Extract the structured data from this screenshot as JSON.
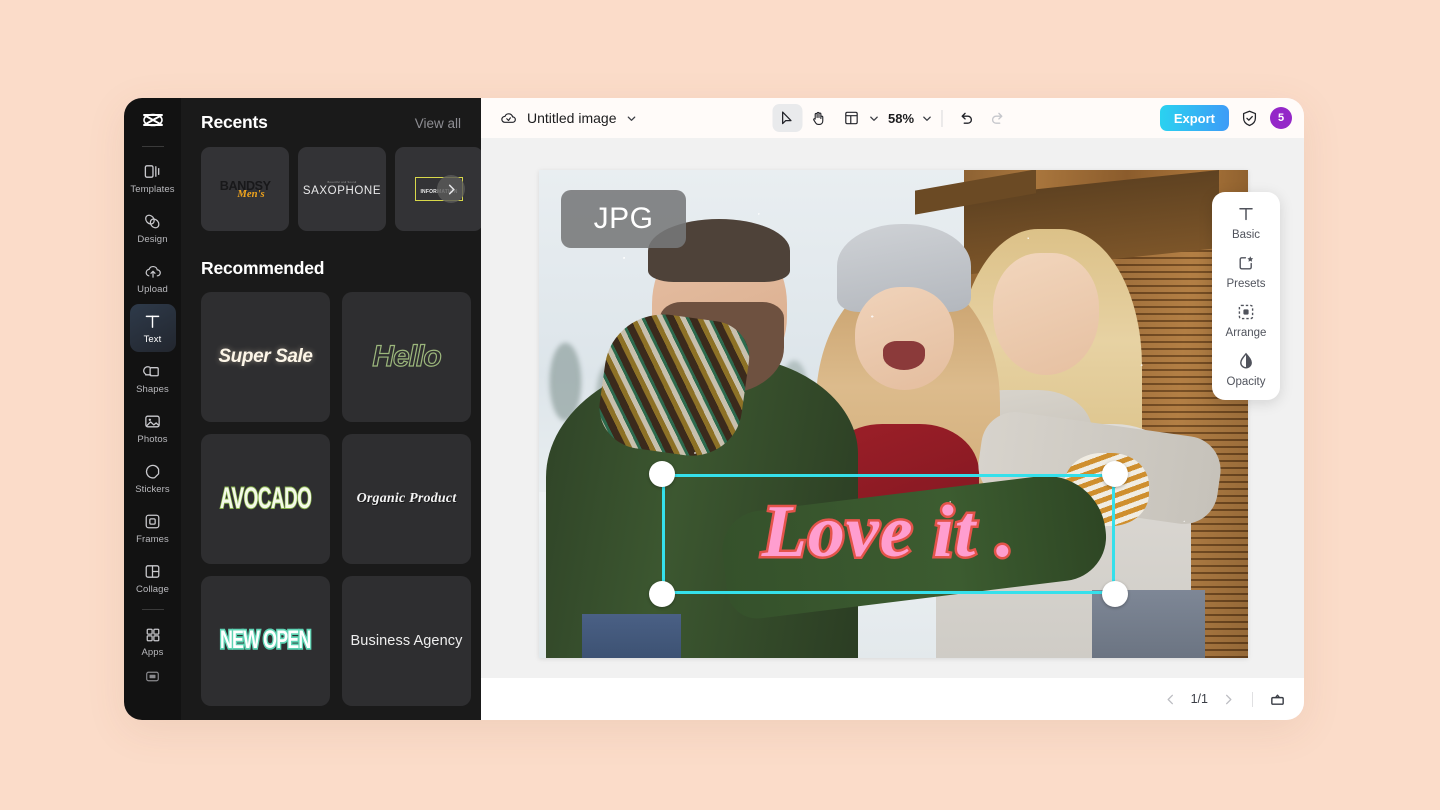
{
  "app": {
    "logo_icon": "capcut-logo-icon"
  },
  "rail": {
    "items": [
      {
        "label": "Templates",
        "icon": "templates-icon",
        "active": false
      },
      {
        "label": "Design",
        "icon": "design-icon",
        "active": false
      },
      {
        "label": "Upload",
        "icon": "upload-cloud-icon",
        "active": false
      },
      {
        "label": "Text",
        "icon": "text-t-icon",
        "active": true
      },
      {
        "label": "Shapes",
        "icon": "shapes-icon",
        "active": false
      },
      {
        "label": "Photos",
        "icon": "photos-image-icon",
        "active": false
      },
      {
        "label": "Stickers",
        "icon": "stickers-icon",
        "active": false
      },
      {
        "label": "Frames",
        "icon": "frames-icon",
        "active": false
      },
      {
        "label": "Collage",
        "icon": "collage-icon",
        "active": false
      },
      {
        "label": "Apps",
        "icon": "apps-grid-icon",
        "active": false
      }
    ],
    "bottom_icon": "keyboard-icon"
  },
  "panel": {
    "recents_title": "Recents",
    "view_all": "View all",
    "recents": [
      {
        "line1": "BANDSY",
        "line2": "Men's"
      },
      {
        "line1": "Beautiful and Sound",
        "line2": "SAXOPHONE"
      },
      {
        "line1": "INFORMATION",
        "line2": ""
      }
    ],
    "next_icon": "chevron-right-icon",
    "recommended_title": "Recommended",
    "recommended": [
      {
        "label": "Super Sale"
      },
      {
        "label": "Hello"
      },
      {
        "label": "AVOCADO"
      },
      {
        "label": "Organic Product"
      },
      {
        "label": "NEW OPEN"
      },
      {
        "label": "Business Agency"
      }
    ]
  },
  "topbar": {
    "cloud_icon": "cloud-save-icon",
    "doc_title": "Untitled image",
    "doc_chevron": "chevron-down-icon",
    "tools": [
      {
        "name": "select-tool",
        "icon": "cursor-arrow-icon",
        "active": true
      },
      {
        "name": "hand-tool",
        "icon": "hand-icon",
        "active": false
      },
      {
        "name": "layout-tool",
        "icon": "layout-panel-icon",
        "active": false
      }
    ],
    "zoom": "58%",
    "undo_icon": "undo-arrow-icon",
    "redo_icon": "redo-arrow-icon",
    "export_label": "Export",
    "shield_icon": "shield-check-icon",
    "avatar_count": "5",
    "avatar_color": "#9427C8",
    "export_color": "#2AD2F0"
  },
  "canvas": {
    "format_badge": "JPG",
    "text_object": {
      "content": "Love it .",
      "fill_color": "#FF9ECF",
      "stroke_color": "#E4534A"
    },
    "selection_color": "#35E0EB"
  },
  "float_panel": {
    "items": [
      {
        "label": "Basic",
        "icon": "text-t-icon"
      },
      {
        "label": "Presets",
        "icon": "presets-star-square-icon"
      },
      {
        "label": "Arrange",
        "icon": "arrange-dashed-box-icon"
      },
      {
        "label": "Opacity",
        "icon": "opacity-droplet-icon"
      }
    ]
  },
  "bottombar": {
    "prev_icon": "chevron-left-icon",
    "page_indicator": "1/1",
    "next_icon": "chevron-right-icon",
    "fit_icon": "fit-screen-icon"
  }
}
